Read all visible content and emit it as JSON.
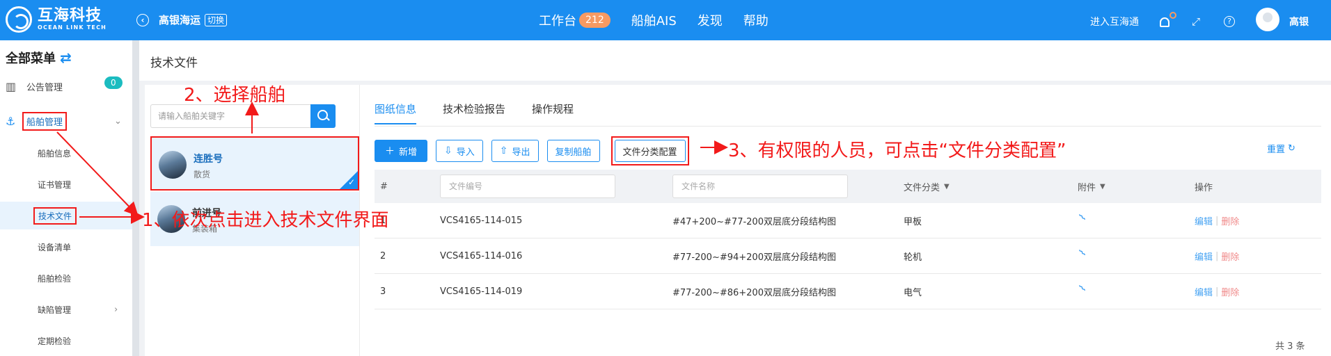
{
  "header": {
    "brand_cn": "互海科技",
    "brand_en": "OCEAN LINK TECH",
    "current_ship": "高银海运",
    "switch_label": "切换",
    "nav": [
      {
        "label": "工作台",
        "badge": "212"
      },
      {
        "label": "船舶AIS"
      },
      {
        "label": "发现"
      },
      {
        "label": "帮助"
      }
    ],
    "enter_label": "进入互海通",
    "user_name": "高银"
  },
  "sidebar": {
    "title": "全部菜单",
    "items": [
      {
        "label": "公告管理",
        "badge": "0"
      },
      {
        "label": "船舶管理"
      },
      {
        "label": "船舶信息"
      },
      {
        "label": "证书管理"
      },
      {
        "label": "技术文件"
      },
      {
        "label": "设备清单"
      },
      {
        "label": "船舶检验"
      },
      {
        "label": "缺陷管理"
      },
      {
        "label": "定期检验"
      }
    ]
  },
  "page": {
    "title": "技术文件"
  },
  "ships": {
    "search_placeholder": "请输入船舶关键字",
    "list": [
      {
        "name": "连胜号",
        "type": "散货"
      },
      {
        "name": "前进号",
        "type": "集装箱"
      }
    ]
  },
  "tabs": [
    "图纸信息",
    "技术检验报告",
    "操作规程"
  ],
  "toolbar": {
    "add": "新增",
    "import": "导入",
    "export": "导出",
    "copy": "复制船舶",
    "config": "文件分类配置",
    "reset": "重置"
  },
  "table": {
    "col_index": "#",
    "filter_number_placeholder": "文件编号",
    "filter_name_placeholder": "文件名称",
    "col_category": "文件分类",
    "col_attachment": "附件",
    "col_ops": "操作",
    "edit": "编辑",
    "delete": "删除",
    "rows": [
      {
        "index": "1",
        "number": "VCS4165-114-015",
        "name": "#47+200~#77-200双层底分段结构图",
        "category": "甲板"
      },
      {
        "index": "2",
        "number": "VCS4165-114-016",
        "name": "#77-200~#94+200双层底分段结构图",
        "category": "轮机"
      },
      {
        "index": "3",
        "number": "VCS4165-114-019",
        "name": "#77-200~#86+200双层底分段结构图",
        "category": "电气"
      }
    ],
    "total": "共 3 条"
  },
  "annotations": {
    "step1": "1、依次点击进入技术文件界面",
    "step2": "2、选择船舶",
    "step3": "3、有权限的人员，可点击“文件分类配置”",
    "color": "#f21a1a"
  },
  "colors": {
    "primary": "#1a8df0",
    "badge_orange": "#f79a62",
    "badge_cyan": "#1bbcc0"
  }
}
